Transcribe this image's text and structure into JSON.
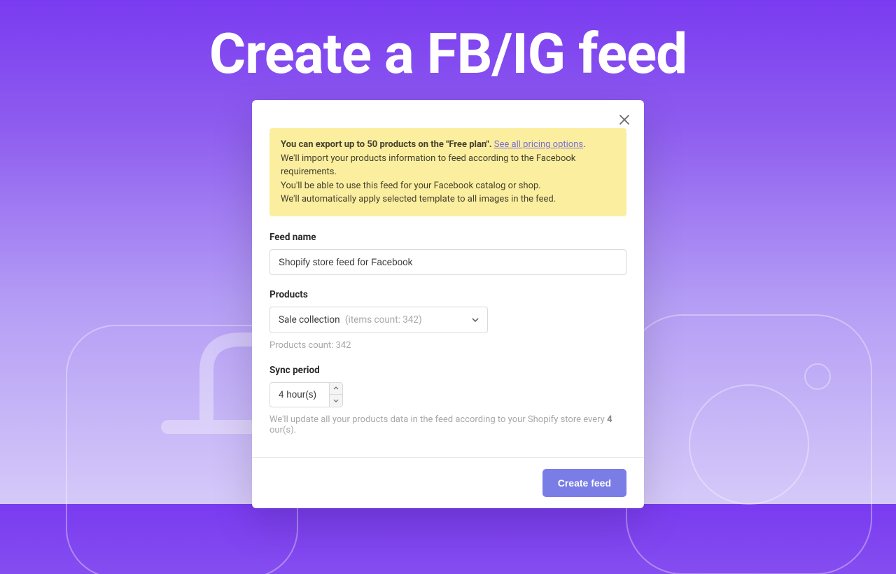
{
  "page": {
    "title": "Create a FB/IG feed"
  },
  "banner": {
    "line1_strong": "You can export up to 50 products on the \"Free plan\".",
    "link": "See all pricing options",
    "period": ".",
    "line2": "We'll import your products information to feed according to the Facebook requirements.",
    "line3": "You'll be able to use this feed for your Facebook catalog or shop.",
    "line4": "We'll automatically apply selected template to all images in the feed."
  },
  "form": {
    "feed_name": {
      "label": "Feed name",
      "value": "Shopify store feed for Facebook"
    },
    "products": {
      "label": "Products",
      "selected_name": "Sale collection",
      "selected_detail": "(items count: 342)",
      "helper": "Products count: 342"
    },
    "sync": {
      "label": "Sync period",
      "value": "4 hour(s)",
      "helper_pre": "We'll update all your products data in the feed according to your Shopify store every ",
      "helper_bold": "4",
      "helper_post": " our(s)."
    }
  },
  "footer": {
    "create_label": "Create feed"
  }
}
